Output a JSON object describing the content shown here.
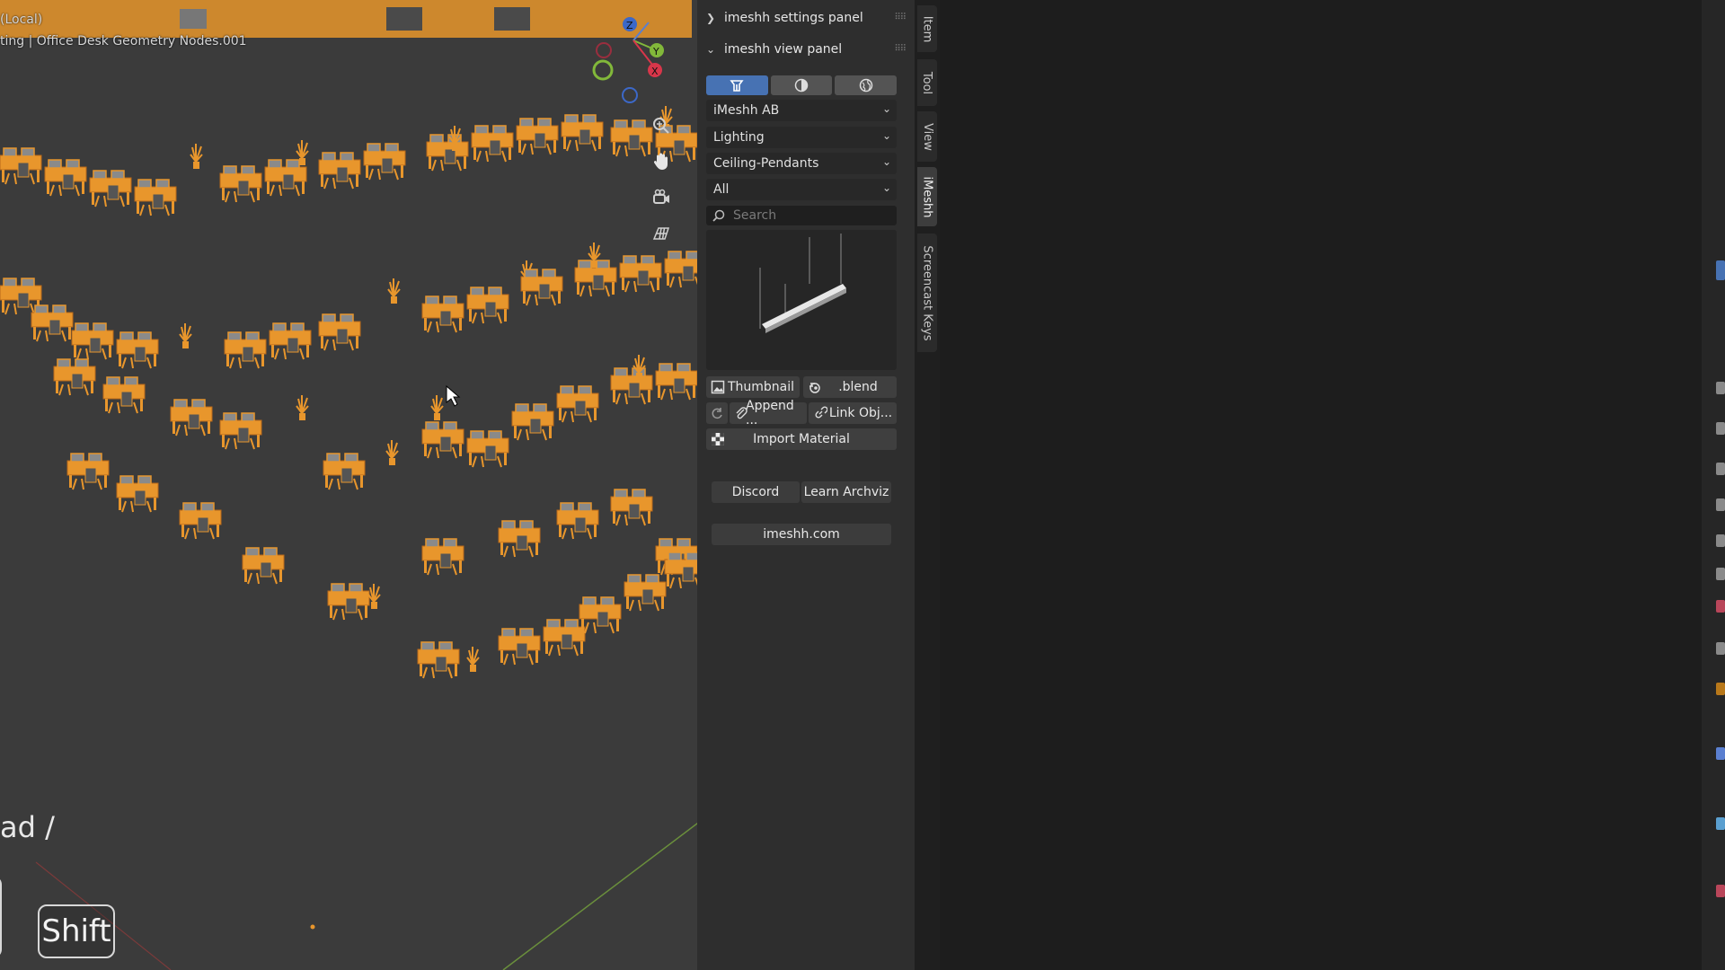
{
  "viewport": {
    "local_label": "(Local)",
    "object_label": "ting | Office Desk Geometry Nodes.001",
    "shortcut_text": "ad /",
    "shift_key": "Shift",
    "axis_labels": {
      "z": "Z",
      "y": "Y",
      "x": "X"
    },
    "colors": {
      "desk_orange": "#e8962c",
      "background": "#3b3b3b"
    }
  },
  "panel": {
    "settings_header": "imeshh settings panel",
    "view_header": "imeshh view panel",
    "mode_buttons": [
      {
        "icon": "models-icon",
        "active": true
      },
      {
        "icon": "materials-icon",
        "active": false
      },
      {
        "icon": "world-icon",
        "active": false
      }
    ],
    "dropdowns": {
      "library": "iMeshh AB",
      "category": "Lighting",
      "subcategory": "Ceiling-Pendants",
      "filter": "All"
    },
    "search_placeholder": "Search",
    "buttons": {
      "thumbnail": "Thumbnail",
      "blend": ".blend",
      "append": "Append ...",
      "link": "Link Obj...",
      "import_material": "Import Material",
      "discord": "Discord",
      "learn_archviz": "Learn Archviz",
      "website": "imeshh.com"
    },
    "accent_color": "#4772b3"
  },
  "tabs": [
    "Item",
    "Tool",
    "View",
    "iMeshh",
    "Screencast Keys"
  ]
}
